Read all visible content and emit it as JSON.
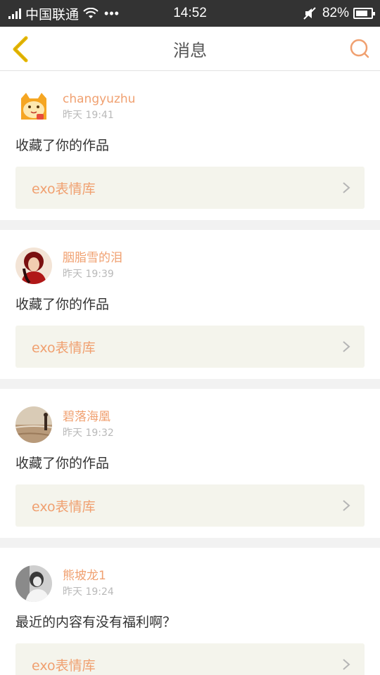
{
  "status_bar": {
    "carrier": "中国联通",
    "dots": "•••",
    "time": "14:52",
    "battery_percent": "82%",
    "battery_level": 0.82
  },
  "header": {
    "title": "消息",
    "back_icon": "chevron-left-icon",
    "search_icon": "search-icon",
    "accent_color": "#f0a070",
    "back_color": "#e8b800"
  },
  "messages": [
    {
      "username": "changyuzhu",
      "time": "昨天 19:41",
      "text": "收藏了你的作品",
      "work_title": "exo表情库"
    },
    {
      "username": "胭脂雪的泪",
      "time": "昨天 19:39",
      "text": "收藏了你的作品",
      "work_title": "exo表情库"
    },
    {
      "username": "碧落海凰",
      "time": "昨天 19:32",
      "text": "收藏了你的作品",
      "work_title": "exo表情库"
    },
    {
      "username": "熊坡龙1",
      "time": "昨天 19:24",
      "text": "最近的内容有没有福利啊？",
      "work_title": "exo表情库"
    }
  ]
}
